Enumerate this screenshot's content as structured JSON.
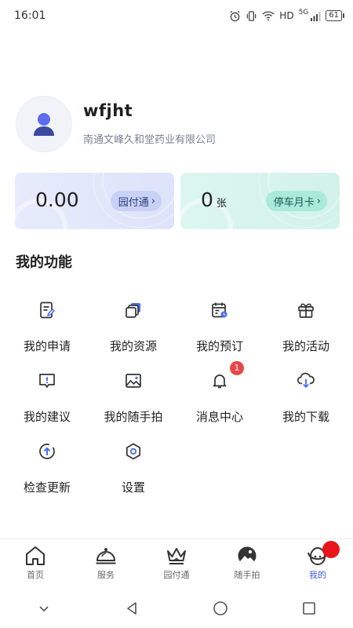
{
  "status": {
    "time": "16:01",
    "network": "HD",
    "signal": "5G",
    "battery": "61"
  },
  "profile": {
    "username": "wfjht",
    "company": "南通文峰久和堂药业有限公司"
  },
  "cards": {
    "balance": {
      "value": "0.00",
      "button": "园付通"
    },
    "parking": {
      "value": "0",
      "unit": "张",
      "button": "停车月卡"
    }
  },
  "functions": {
    "title": "我的功能",
    "items": [
      {
        "label": "我的申请",
        "icon": "application-icon"
      },
      {
        "label": "我的资源",
        "icon": "resources-icon"
      },
      {
        "label": "我的预订",
        "icon": "booking-icon"
      },
      {
        "label": "我的活动",
        "icon": "gift-icon"
      },
      {
        "label": "我的建议",
        "icon": "suggestion-icon"
      },
      {
        "label": "我的随手拍",
        "icon": "photo-icon"
      },
      {
        "label": "消息中心",
        "icon": "bell-icon",
        "badge": "1"
      },
      {
        "label": "我的下载",
        "icon": "download-icon"
      },
      {
        "label": "检查更新",
        "icon": "update-icon"
      },
      {
        "label": "设置",
        "icon": "settings-icon"
      }
    ]
  },
  "tabs": [
    {
      "label": "首页",
      "icon": "home-icon"
    },
    {
      "label": "服务",
      "icon": "service-icon"
    },
    {
      "label": "园付通",
      "icon": "crown-icon"
    },
    {
      "label": "随手拍",
      "icon": "camera-icon"
    },
    {
      "label": "我的",
      "icon": "profile-icon",
      "active": true
    }
  ],
  "colors": {
    "accent": "#3b5bdb",
    "badge": "#e64848",
    "icon": "#333333",
    "icon_accent": "#4a6cf7"
  }
}
